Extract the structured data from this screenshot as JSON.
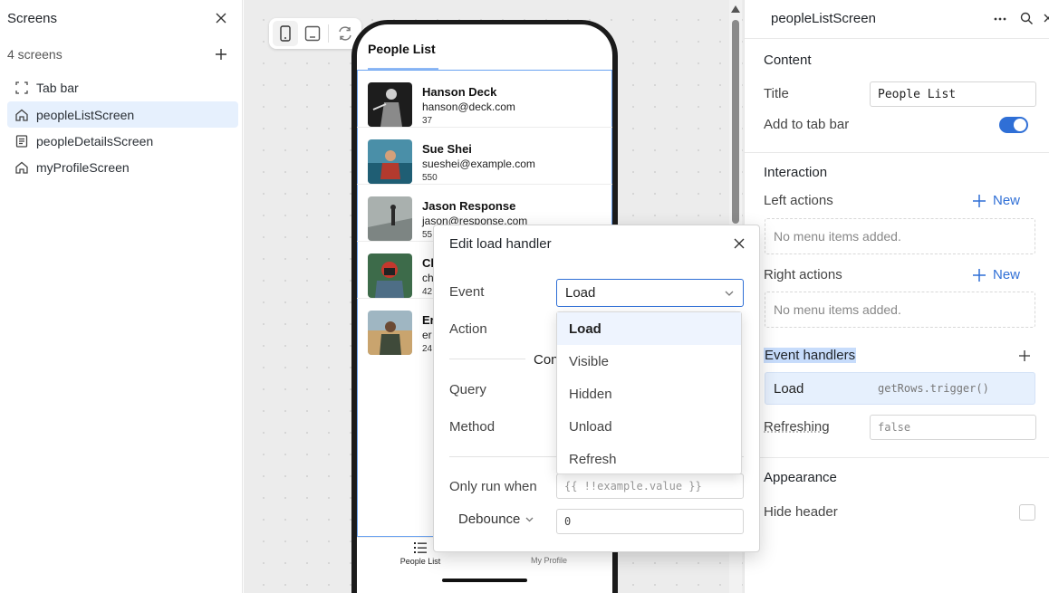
{
  "left_panel": {
    "title": "Screens",
    "count": "4 screens",
    "items": [
      {
        "label": "Tab bar"
      },
      {
        "label": "peopleListScreen"
      },
      {
        "label": "peopleDetailsScreen"
      },
      {
        "label": "myProfileScreen"
      }
    ]
  },
  "phone": {
    "title": "People List",
    "rows": [
      {
        "name": "Hanson Deck",
        "email": "hanson@deck.com",
        "number": "37"
      },
      {
        "name": "Sue Shei",
        "email": "sueshei@example.com",
        "number": "550"
      },
      {
        "name": "Jason Response",
        "email": "jason@response.com",
        "number": "55"
      },
      {
        "name": "Cl",
        "email": "ch",
        "number": "42"
      },
      {
        "name": "Er",
        "email": "er",
        "number": "24"
      }
    ],
    "tabs": [
      {
        "label": "People List"
      },
      {
        "label": "My Profile"
      }
    ]
  },
  "right_panel": {
    "screen_name": "peopleListScreen",
    "content": {
      "heading": "Content",
      "title_label": "Title",
      "title_value": "People List",
      "tabbar_label": "Add to tab bar",
      "tabbar_on": true
    },
    "interaction": {
      "heading": "Interaction",
      "left_actions_label": "Left actions",
      "right_actions_label": "Right actions",
      "new_label": "New",
      "empty_text": "No menu items added."
    },
    "event_handlers": {
      "heading": "Event handlers",
      "handler_name": "Load",
      "handler_code": "getRows.trigger()"
    },
    "refreshing": {
      "label": "Refreshing",
      "value": "false"
    },
    "appearance": {
      "heading": "Appearance",
      "hide_header_label": "Hide header"
    }
  },
  "modal": {
    "title": "Edit load handler",
    "event_label": "Event",
    "event_value": "Load",
    "action_label": "Action",
    "divider_text": "Con",
    "query_label": "Query",
    "method_label": "Method",
    "only_run_label": "Only run when",
    "only_run_placeholder": "{{ !!example.value }}",
    "debounce_label": "Debounce",
    "debounce_value": "0",
    "options": [
      {
        "label": "Load",
        "active": true
      },
      {
        "label": "Visible"
      },
      {
        "label": "Hidden"
      },
      {
        "label": "Unload"
      },
      {
        "label": "Refresh"
      }
    ]
  },
  "colors": {
    "accent": "#2f6fd6",
    "selection": "#e6f0fd",
    "highlight": "#c7dcfb"
  }
}
